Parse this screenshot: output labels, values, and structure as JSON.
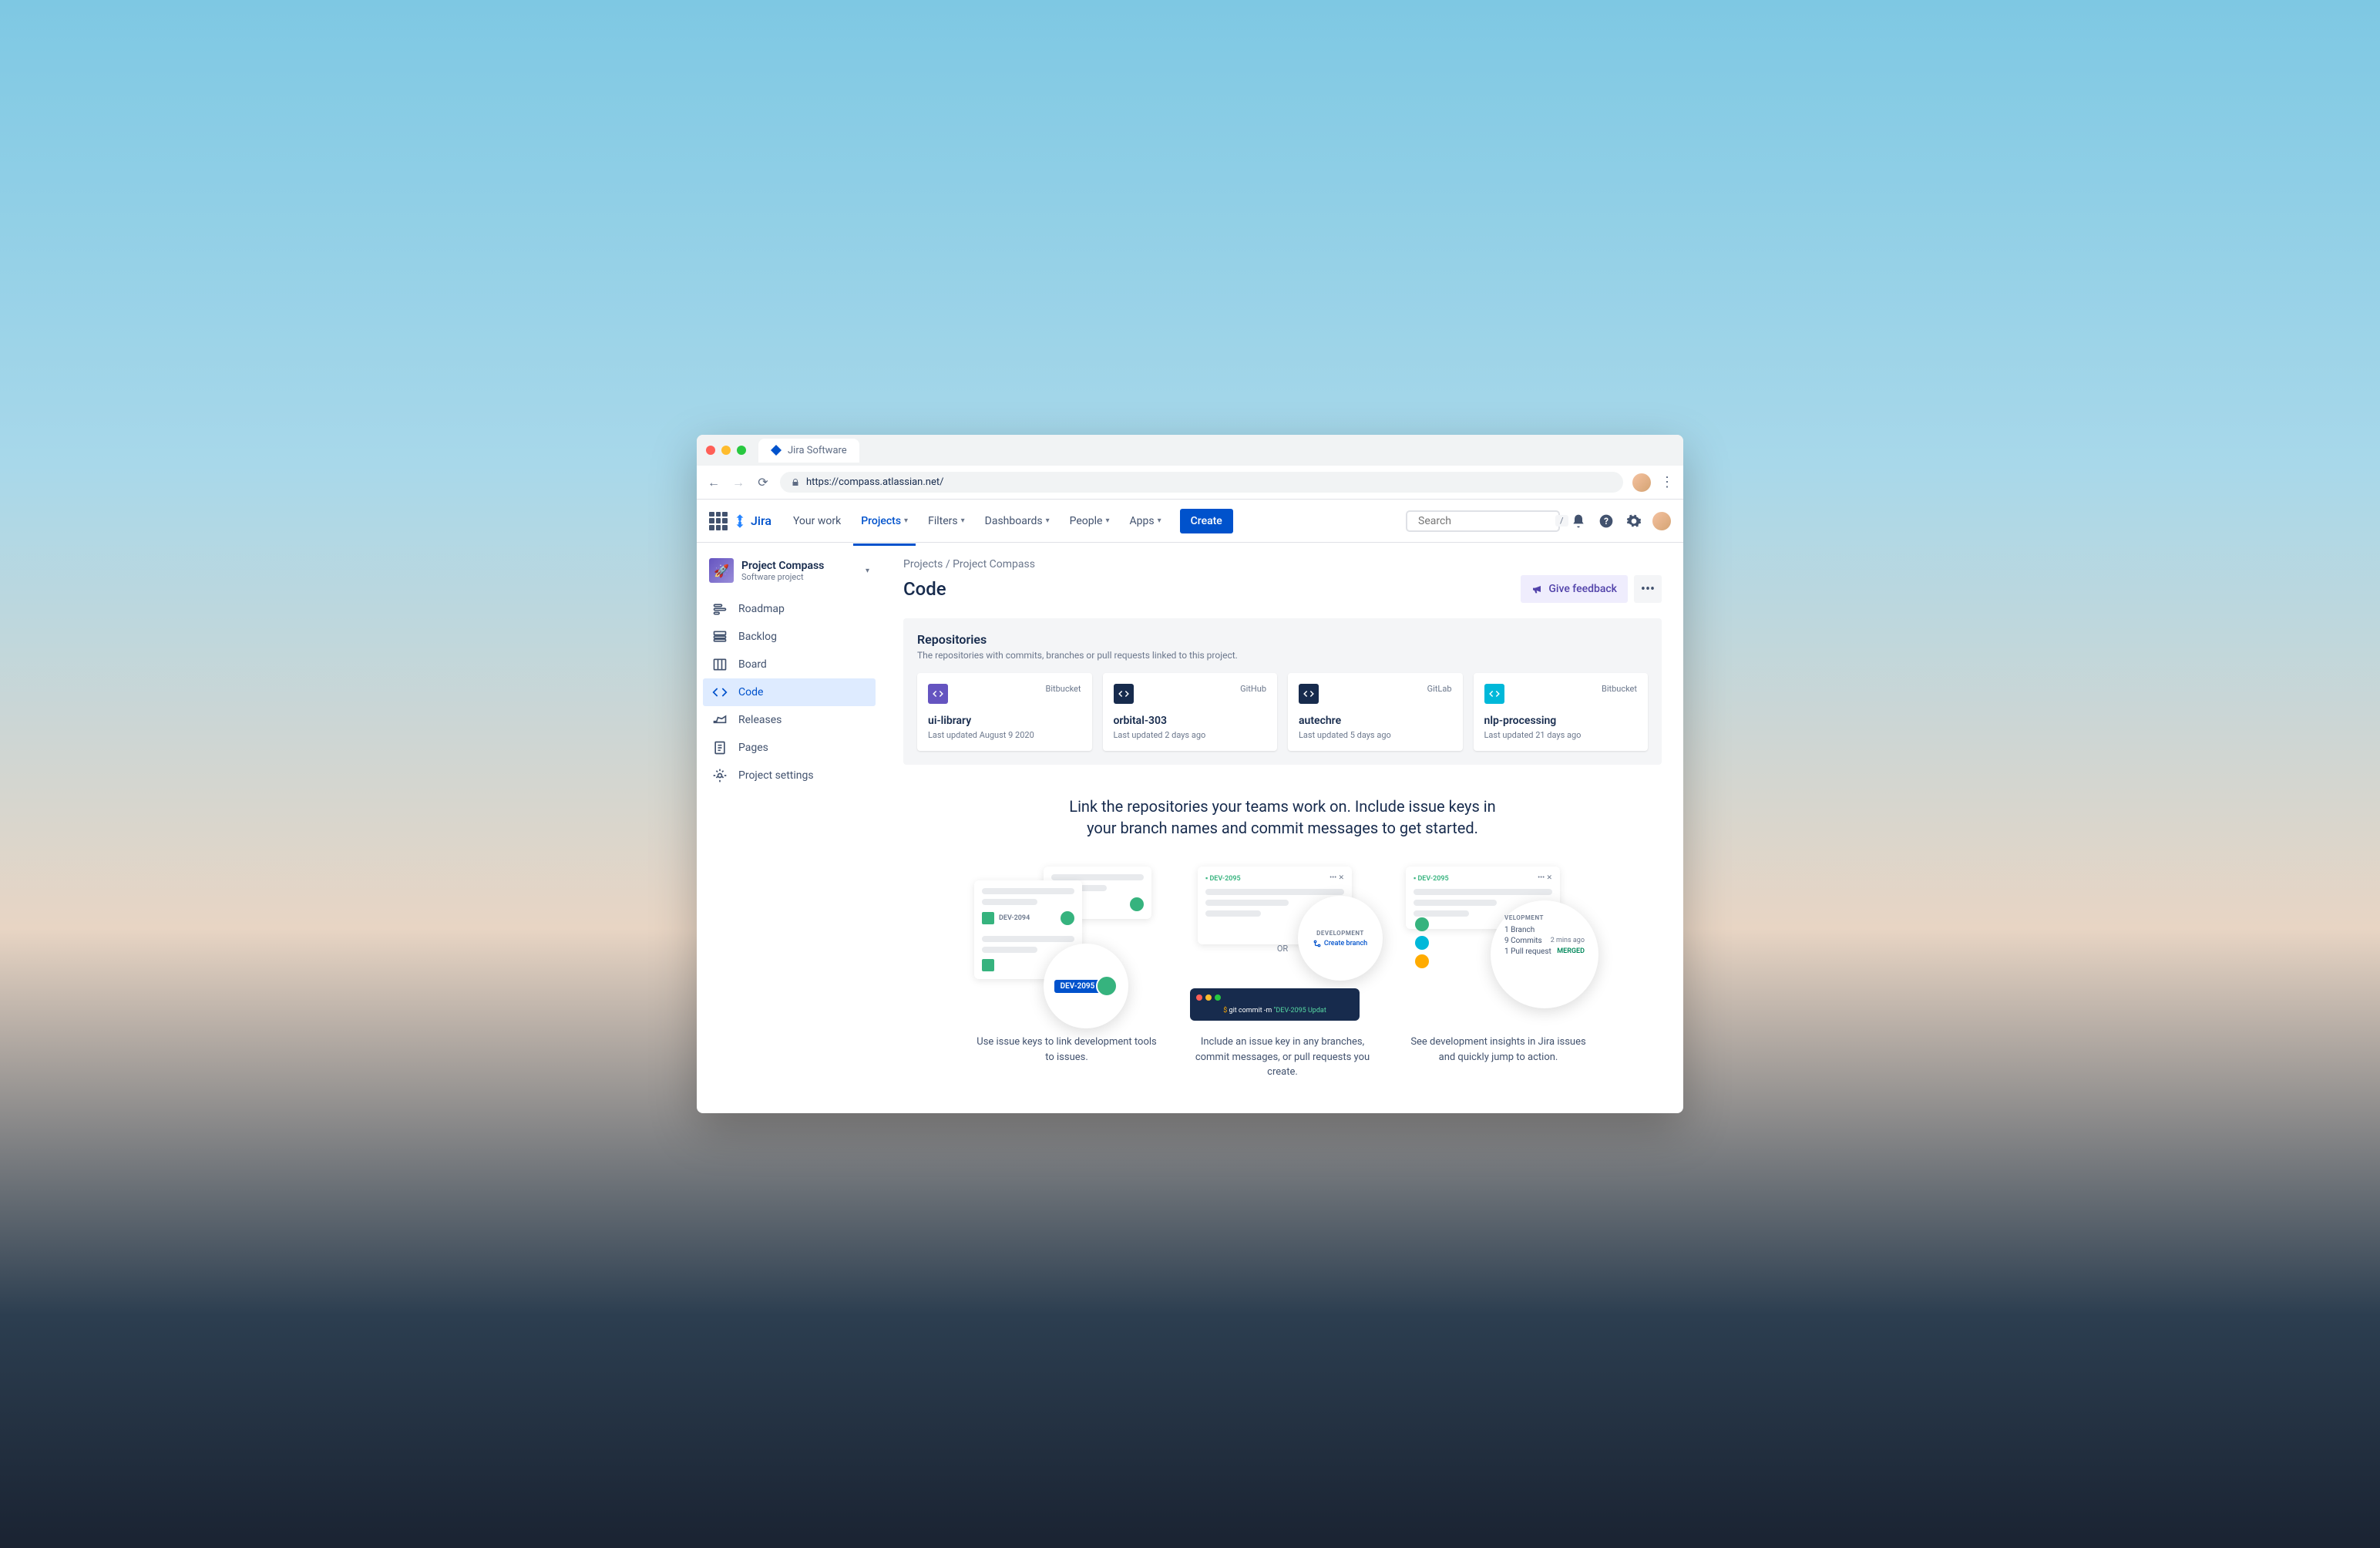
{
  "browser": {
    "tab_title": "Jira Software",
    "url": "https://compass.atlassian.net/"
  },
  "nav": {
    "product": "Jira",
    "items": [
      "Your work",
      "Projects",
      "Filters",
      "Dashboards",
      "People",
      "Apps"
    ],
    "active_index": 1,
    "create": "Create",
    "search_placeholder": "Search",
    "search_shortcut": "/"
  },
  "project": {
    "name": "Project Compass",
    "type": "Software project",
    "emoji": "🚀"
  },
  "sidebar": [
    {
      "label": "Roadmap",
      "icon": "roadmap"
    },
    {
      "label": "Backlog",
      "icon": "backlog"
    },
    {
      "label": "Board",
      "icon": "board"
    },
    {
      "label": "Code",
      "icon": "code",
      "active": true
    },
    {
      "label": "Releases",
      "icon": "releases"
    },
    {
      "label": "Pages",
      "icon": "pages"
    },
    {
      "label": "Project settings",
      "icon": "settings"
    }
  ],
  "breadcrumb": {
    "root": "Projects",
    "current": "Project Compass"
  },
  "page": {
    "title": "Code",
    "feedback": "Give feedback"
  },
  "repos": {
    "title": "Repositories",
    "subtitle": "The repositories with commits, branches or pull requests linked to this project.",
    "items": [
      {
        "name": "ui-library",
        "provider": "Bitbucket",
        "updated": "Last updated August 9 2020",
        "color": "#6554c0"
      },
      {
        "name": "orbital-303",
        "provider": "GitHub",
        "updated": "Last updated 2 days ago",
        "color": "#172b4d"
      },
      {
        "name": "autechre",
        "provider": "GitLab",
        "updated": "Last updated 5 days ago",
        "color": "#172b4d"
      },
      {
        "name": "nlp-processing",
        "provider": "Bitbucket",
        "updated": "Last updated 21 days ago",
        "color": "#00b8d9"
      }
    ]
  },
  "hero": "Link the repositories your teams work on. Include issue keys in your branch names and commit messages to get started.",
  "illus": {
    "col1": {
      "tag1": "DEV-2094",
      "tag2": "DEV-2095",
      "text": "Use issue keys to link development tools to issues."
    },
    "col2": {
      "issue": "DEV-2095",
      "dev_label": "DEVELOPMENT",
      "branch": "Create branch",
      "or": "OR",
      "cmd_prefix": "$ ",
      "cmd_git": "git commit -m ",
      "cmd_msg": "\"DEV-2095 Updat",
      "text": "Include an issue key in any branches, commit messages, or pull requests you create."
    },
    "col3": {
      "issue": "DEV-2095",
      "dev_label": "VELOPMENT",
      "branch_label": "1 Branch",
      "commits_label": "9 Commits",
      "commits_time": "2 mins ago",
      "pr_label": "1 Pull request",
      "pr_status": "MERGED",
      "text": "See development insights in Jira issues and quickly jump to action."
    }
  }
}
